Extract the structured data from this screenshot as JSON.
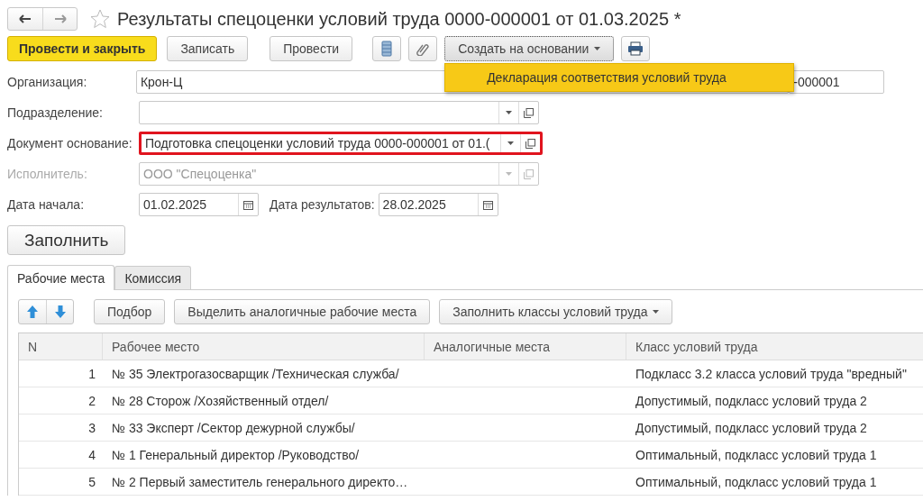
{
  "window": {
    "title": "Результаты спецоценки условий труда 0000-000001 от 01.03.2025 *",
    "favorite": false
  },
  "toolbar": [
    {
      "kind": "primary",
      "label": "Провести и закрыть"
    },
    {
      "kind": "button",
      "label": "Записать"
    },
    {
      "kind": "button",
      "label": "Провести"
    },
    {
      "kind": "list-icon"
    },
    {
      "kind": "clip-icon"
    },
    {
      "kind": "menu",
      "label": "Создать на основании",
      "expanded": true,
      "items": [
        {
          "label": "Декларация соответствия условий труда",
          "selected": true
        }
      ]
    },
    {
      "kind": "print-icon"
    }
  ],
  "form": [
    {
      "kind": "text",
      "label": "Организация:",
      "value": "Крон-Ц",
      "disabled": false,
      "highlighted": false,
      "extra_value": "-000001"
    },
    {
      "kind": "select",
      "label": "Подразделение:",
      "disabled": false,
      "highlighted": false
    },
    {
      "kind": "select",
      "label": "Документ основание:",
      "value": "Подготовка спецоценки условий труда 0000-000001 от 01.(",
      "disabled": false,
      "highlighted": true
    },
    {
      "kind": "select",
      "label": "Исполнитель:",
      "value": "ООО \"Спецоценка\"",
      "disabled": true,
      "highlighted": false
    },
    {
      "kind": "dates",
      "label": "Дата начала:",
      "value": "01.02.2025",
      "label2": "Дата результатов:",
      "value2": "28.02.2025",
      "disabled": false,
      "highlighted": false
    }
  ],
  "fill_button": "Заполнить",
  "tabs": [
    {
      "label": "Рабочие места",
      "selected": true
    },
    {
      "label": "Комиссия",
      "selected": false
    }
  ],
  "table_toolbar": [
    "Подбор",
    "Выделить аналогичные рабочие места",
    "Заполнить классы условий труда"
  ],
  "table": {
    "columns": [
      "N",
      "Рабочее место",
      "Аналогичные места",
      "Класс условий труда"
    ],
    "rows": [
      [
        "1",
        "№ 35 Электрогазосварщик /Техническая служба/",
        "",
        "Подкласс 3.2 класса условий труда \"вредный\""
      ],
      [
        "2",
        "№ 28 Сторож /Хозяйственный отдел/",
        "",
        "Допустимый, подкласс условий труда 2"
      ],
      [
        "3",
        "№ 33 Эксперт /Сектор дежурной службы/",
        "",
        "Допустимый, подкласс условий труда 2"
      ],
      [
        "4",
        "№ 1 Генеральный директор /Руководство/",
        "",
        "Оптимальный, подкласс условий труда 1"
      ],
      [
        "5",
        "№ 2 Первый заместитель генерального директо…",
        "",
        "Оптимальный, подкласс условий труда 1"
      ]
    ]
  }
}
